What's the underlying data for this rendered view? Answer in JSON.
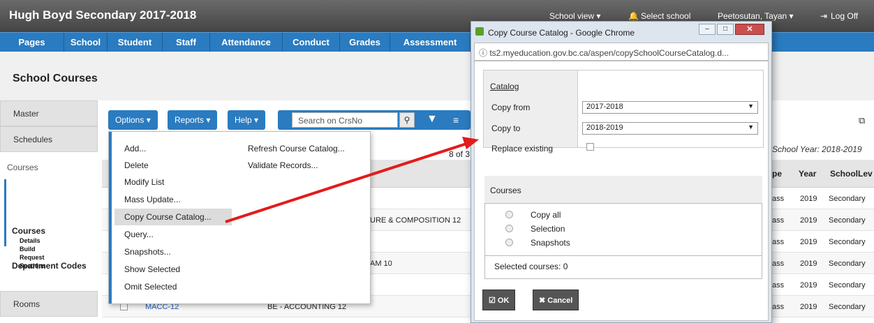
{
  "header": {
    "school_name": "Hugh Boyd Secondary 2017-2018",
    "school_view": "School view ▾",
    "select_school": "Select school",
    "user": "Peetosutan, Tayan ▾",
    "logoff": "Log Off"
  },
  "nav": {
    "tabs": [
      "Pages",
      "School",
      "Student",
      "Staff",
      "Attendance",
      "Conduct",
      "Grades",
      "Assessment"
    ]
  },
  "page": {
    "title": "School Courses"
  },
  "leftnav": {
    "master": "Master",
    "schedules": "Schedules",
    "courses_section": "Courses",
    "courses": "Courses",
    "details": "Details",
    "build": "Build",
    "request": "Request",
    "sections": "Sections",
    "department_codes": "Department Codes",
    "rooms": "Rooms"
  },
  "toolbar": {
    "options": "Options ▾",
    "reports": "Reports ▾",
    "help": "Help ▾",
    "search_placeholder": "Search on CrsNo"
  },
  "menu": {
    "left": [
      "Add...",
      "Delete",
      "Modify List",
      "Mass Update...",
      "Copy Course Catalog...",
      "Query...",
      "Snapshots...",
      "Show Selected",
      "Omit Selected"
    ],
    "right": [
      "Refresh Course Catalog...",
      "Validate Records..."
    ]
  },
  "list": {
    "count_fragment": "8 of 3",
    "school_year": "School Year: 2018-2019",
    "headers": [
      "pe",
      "Year",
      "SchoolLev"
    ],
    "rows": [
      {
        "course": "",
        "desc": "",
        "pe": "ass",
        "year": "2019",
        "level": "Secondary"
      },
      {
        "course": "",
        "desc": "URE & COMPOSITION 12",
        "pe": "ass",
        "year": "2019",
        "level": "Secondary"
      },
      {
        "course": "",
        "desc": "",
        "pe": "ass",
        "year": "2019",
        "level": "Secondary"
      },
      {
        "course": "",
        "desc": "AM 10",
        "pe": "ass",
        "year": "2019",
        "level": "Secondary"
      },
      {
        "course": "",
        "desc": "",
        "pe": "ass",
        "year": "2019",
        "level": "Secondary"
      },
      {
        "course": "MACC-12",
        "desc": "BE - ACCOUNTING 12",
        "pe": "ass",
        "year": "2019",
        "level": "Secondary"
      }
    ]
  },
  "dialog": {
    "title": "Copy Course Catalog - Google Chrome",
    "url": "ts2.myeducation.gov.bc.ca/aspen/copySchoolCourseCatalog.d...",
    "catalog_label": "Catalog",
    "copy_from_label": "Copy from",
    "copy_from_value": "2017-2018",
    "copy_to_label": "Copy to",
    "copy_to_value": "2018-2019",
    "replace_label": "Replace existing",
    "courses_label": "Courses",
    "options": [
      "Copy all",
      "Selection",
      "Snapshots"
    ],
    "selected_label": "Selected courses:  0",
    "ok": "OK",
    "cancel": "Cancel"
  },
  "colors": {
    "nav_blue": "#2a7bc0",
    "arrow": "#e31b1b"
  }
}
